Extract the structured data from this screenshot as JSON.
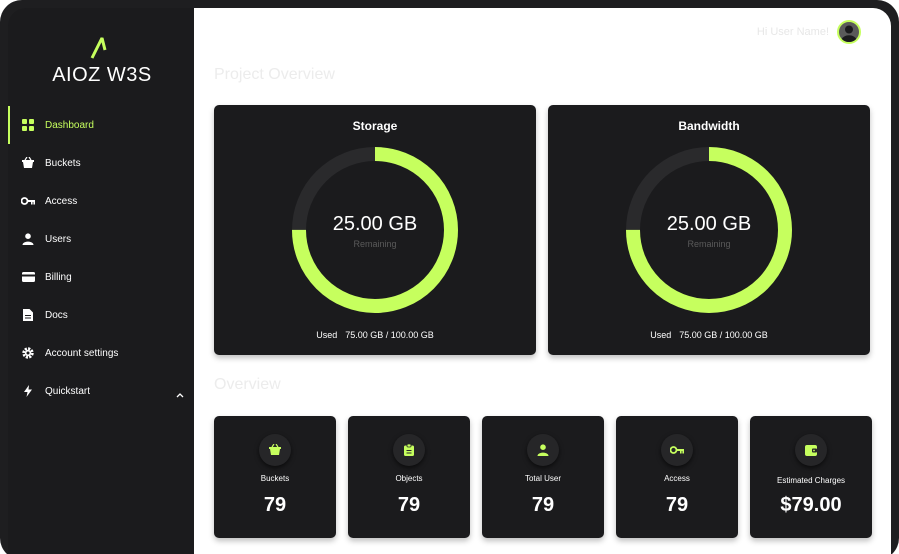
{
  "brand": {
    "logo_text": "AIOZ W3S"
  },
  "sidebar": {
    "items": [
      {
        "label": "Dashboard",
        "icon": "grid-icon",
        "active": true
      },
      {
        "label": "Buckets",
        "icon": "basket-icon"
      },
      {
        "label": "Access",
        "icon": "key-icon"
      },
      {
        "label": "Users",
        "icon": "user-icon"
      },
      {
        "label": "Billing",
        "icon": "card-icon"
      },
      {
        "label": "Docs",
        "icon": "document-icon"
      },
      {
        "label": "Account settings",
        "icon": "gear-icon"
      },
      {
        "label": "Quickstart",
        "icon": "bolt-icon",
        "expandable": true
      }
    ]
  },
  "header": {
    "greeting": "Hi User Name!"
  },
  "project_overview": {
    "title": "Project Overview",
    "storage": {
      "title": "Storage",
      "value": "25.00 GB",
      "sub": "Remaining",
      "used_label": "Used",
      "used_value": "75.00 GB / 100.00 GB",
      "used_fraction": 0.75
    },
    "bandwidth": {
      "title": "Bandwidth",
      "value": "25.00 GB",
      "sub": "Remaining",
      "used_label": "Used",
      "used_value": "75.00 GB / 100.00 GB",
      "used_fraction": 0.75
    }
  },
  "overview": {
    "title": "Overview",
    "stats": [
      {
        "label": "Buckets",
        "value": "79",
        "icon": "basket-icon"
      },
      {
        "label": "Objects",
        "value": "79",
        "icon": "clipboard-icon"
      },
      {
        "label": "Total User",
        "value": "79",
        "icon": "user-icon"
      },
      {
        "label": "Access",
        "value": "79",
        "icon": "key-icon"
      },
      {
        "label": "Estimated Charges",
        "value": "$79.00",
        "icon": "wallet-icon"
      }
    ]
  },
  "colors": {
    "accent": "#c6ff5e",
    "panel": "#1b1b1d",
    "track": "#2a2a2c"
  }
}
